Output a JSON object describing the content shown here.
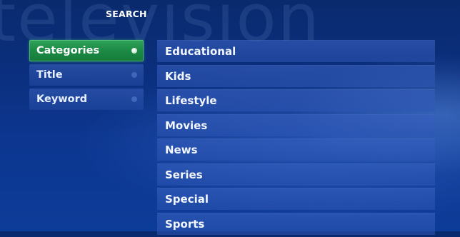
{
  "background": {
    "wordmark": "television"
  },
  "page": {
    "title": "SEARCH"
  },
  "filters": [
    {
      "label": "Categories",
      "selected": true
    },
    {
      "label": "Title",
      "selected": false
    },
    {
      "label": "Keyword",
      "selected": false
    }
  ],
  "categories": [
    {
      "label": "Educational"
    },
    {
      "label": "Kids"
    },
    {
      "label": "Lifestyle"
    },
    {
      "label": "Movies"
    },
    {
      "label": "News"
    },
    {
      "label": "Series"
    },
    {
      "label": "Special"
    },
    {
      "label": "Sports"
    }
  ],
  "colors": {
    "background": "#0c3690",
    "selected": "#1c8a45",
    "text": "#ffffff"
  }
}
